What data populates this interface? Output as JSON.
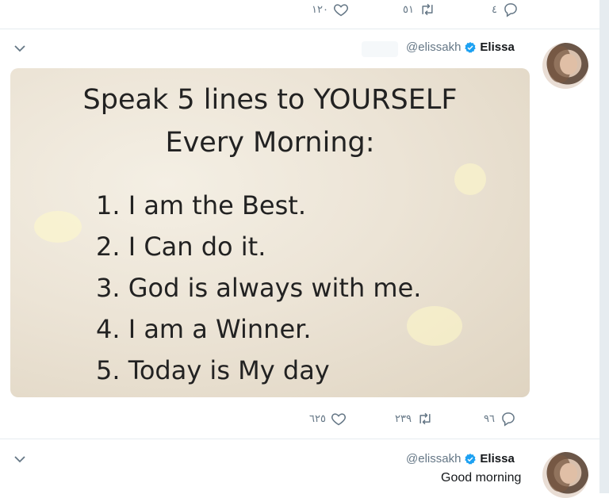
{
  "top_actions": {
    "likes": "١٢٠",
    "retweets": "٥١",
    "replies": "٤"
  },
  "tweet1": {
    "handle": "@elissakh",
    "name": "Elissa",
    "image": {
      "title": "Speak 5 lines to YOURSELF",
      "subtitle": "Every Morning:",
      "lines": [
        "1. I am the Best.",
        "2. I Can do it.",
        "3. God is always with me.",
        "4. I am a Winner.",
        "5. Today is My day"
      ]
    },
    "actions": {
      "likes": "٦٢٥",
      "retweets": "٢٣٩",
      "replies": "٩٦"
    }
  },
  "tweet2": {
    "handle": "@elissakh",
    "name": "Elissa",
    "text": "Good morning"
  },
  "colors": {
    "icon": "#657786",
    "verified": "#1da1f2",
    "border": "#e6ecf0"
  },
  "icons": [
    "heart-icon",
    "retweet-icon",
    "reply-icon",
    "chevron-down-icon",
    "verified-badge-icon"
  ]
}
